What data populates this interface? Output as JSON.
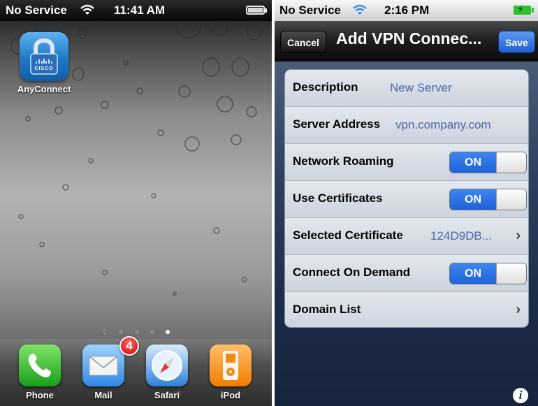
{
  "left_screen": {
    "status_bar": {
      "carrier": "No Service",
      "time": "11:41 AM"
    },
    "home_app": {
      "label": "AnyConnect",
      "icon": "lock-cisco-icon",
      "brand_text": "CISCO"
    },
    "dock": [
      {
        "label": "Phone",
        "icon": "phone-icon"
      },
      {
        "label": "Mail",
        "icon": "mail-icon",
        "badge": "4"
      },
      {
        "label": "Safari",
        "icon": "compass-icon"
      },
      {
        "label": "iPod",
        "icon": "ipod-icon"
      }
    ],
    "page_indicator": {
      "pages": 5,
      "active_page": 5
    }
  },
  "right_screen": {
    "status_bar": {
      "carrier": "No Service",
      "time": "2:16 PM"
    },
    "navbar": {
      "cancel_label": "Cancel",
      "title": "Add VPN Connec...",
      "save_label": "Save"
    },
    "rows": [
      {
        "label": "Description",
        "value": "New Server"
      },
      {
        "label": "Server Address",
        "value": "vpn.company.com"
      },
      {
        "label": "Network Roaming",
        "toggle": "ON"
      },
      {
        "label": "Use Certificates",
        "toggle": "ON"
      },
      {
        "label": "Selected Certificate",
        "value": "124D9DB..."
      },
      {
        "label": "Connect On Demand",
        "toggle": "ON"
      },
      {
        "label": "Domain List"
      }
    ],
    "info_label": "i"
  },
  "colors": {
    "accent_blue": "#2b6ee0",
    "value_blue": "#4b67a5",
    "phone_green": "#1a9f1a"
  }
}
